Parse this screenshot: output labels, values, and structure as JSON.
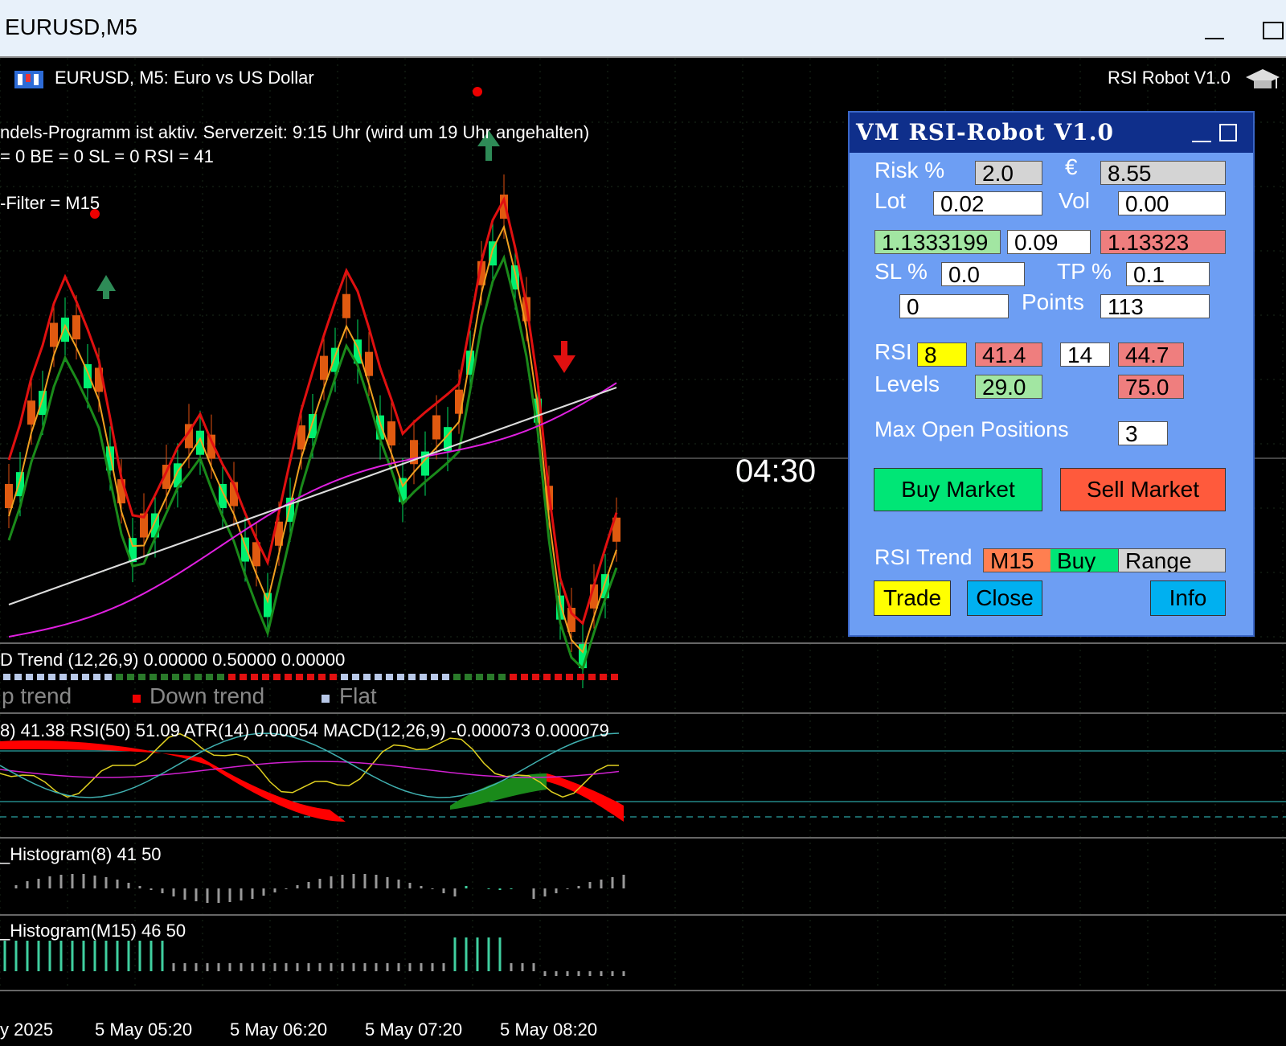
{
  "window": {
    "title": "EURUSD,M5"
  },
  "chart": {
    "header": "EURUSD, M5:  Euro vs US Dollar",
    "robot_label": "RSI Robot V1.0",
    "info_line1": "ndels-Programm ist aktiv. Serverzeit: 9:15 Uhr (wird um 19 Uhr angehalten)",
    "info_line2": "= 0 BE = 0 SL = 0 RSI = 41",
    "info_line3": "-Filter = M15",
    "countdown": "04:30",
    "macd_trend": "D Trend (12,26,9) 0.00000 0.50000 0.00000",
    "legend_up": "p trend",
    "legend_down": "Down trend",
    "legend_flat": "Flat",
    "rsi_line": "8) 41.38 RSI(50) 51.09 ATR(14) 0.00054 MACD(12,26,9) -0.000073 0.000079",
    "hist1": "_Histogram(8) 41 50",
    "hist2": "_Histogram(M15) 46 50",
    "time_axis": [
      "y 2025",
      "5 May 05:20",
      "5 May 06:20",
      "5 May 07:20",
      "5 May 08:20"
    ]
  },
  "panel": {
    "title": "VM RSI-Robot V1.0",
    "risk_label": "Risk %",
    "risk_value": "2.0",
    "euro_symbol": "€",
    "euro_value": "8.55",
    "lot_label": "Lot",
    "lot_value": "0.02",
    "vol_label": "Vol",
    "vol_value": "0.00",
    "bid": "1.1333199",
    "spread": "0.09",
    "ask": "1.13323",
    "sl_label": "SL %",
    "sl_value": "0.0",
    "tp_label": "TP %",
    "tp_value": "0.1",
    "sl_points": "0",
    "points_label": "Points",
    "tp_points": "113",
    "rsi_label": "RSI",
    "rsi_period1": "8",
    "rsi_value1": "41.4",
    "rsi_period2": "14",
    "rsi_value2": "44.7",
    "levels_label": "Levels",
    "level_low": "29.0",
    "level_high": "75.0",
    "max_open_label": "Max Open Positions",
    "max_open_value": "3",
    "buy_label": "Buy Market",
    "sell_label": "Sell Market",
    "trend_label": "RSI Trend",
    "trend_tf": "M15",
    "trend_signal": "Buy",
    "trend_state": "Range",
    "trade_label": "Trade",
    "close_label": "Close",
    "info_label": "Info"
  }
}
